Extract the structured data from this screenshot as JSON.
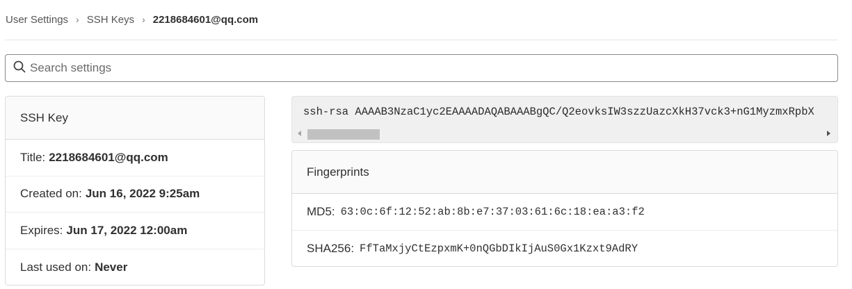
{
  "breadcrumb": {
    "items": [
      "User Settings",
      "SSH Keys"
    ],
    "separator": "›",
    "current": "2218684601@qq.com"
  },
  "search": {
    "placeholder": "Search settings",
    "icon": "search-icon"
  },
  "ssh_key_card": {
    "header": "SSH Key",
    "title_label": "Title:",
    "title_value": "2218684601@qq.com",
    "created_label": "Created on:",
    "created_value": "Jun 16, 2022 9:25am",
    "expires_label": "Expires:",
    "expires_value": "Jun 17, 2022 12:00am",
    "last_used_label": "Last used on:",
    "last_used_value": "Never"
  },
  "key": {
    "text": "ssh-rsa AAAAB3NzaC1yc2EAAAADAQABAAABgQC/Q2eovksIW3szzUazcXkH37vck3+nG1MyzmxRpbX"
  },
  "fingerprints": {
    "header": "Fingerprints",
    "md5_label": "MD5:",
    "md5_value": "63:0c:6f:12:52:ab:8b:e7:37:03:61:6c:18:ea:a3:f2",
    "sha256_label": "SHA256:",
    "sha256_value": "FfTaMxjyCtEzpxmK+0nQGbDIkIjAuS0Gx1Kzxt9AdRY"
  }
}
